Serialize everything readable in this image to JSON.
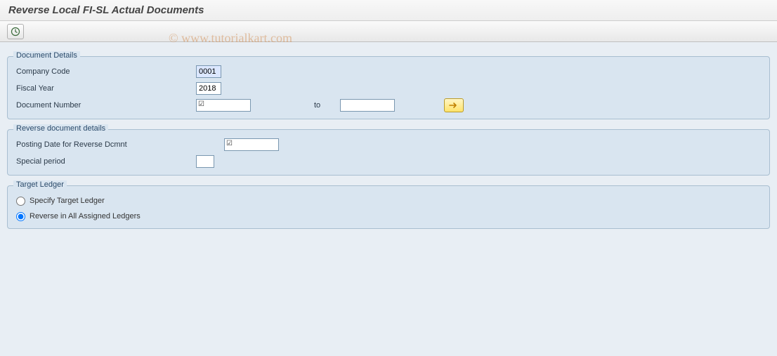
{
  "title": "Reverse Local FI-SL Actual Documents",
  "watermark": "© www.tutorialkart.com",
  "groups": {
    "doc": {
      "title": "Document Details",
      "company_code_label": "Company Code",
      "company_code_value": "0001",
      "fiscal_year_label": "Fiscal Year",
      "fiscal_year_value": "2018",
      "doc_number_label": "Document Number",
      "doc_number_from": "",
      "to_label": "to",
      "doc_number_to": ""
    },
    "rev": {
      "title": "Reverse document details",
      "posting_date_label": "Posting Date for Reverse Dcmnt",
      "posting_date_value": "",
      "special_period_label": "Special period",
      "special_period_value": ""
    },
    "ledger": {
      "title": "Target Ledger",
      "opt_specify": "Specify Target Ledger",
      "opt_all": "Reverse in All Assigned Ledgers"
    }
  }
}
